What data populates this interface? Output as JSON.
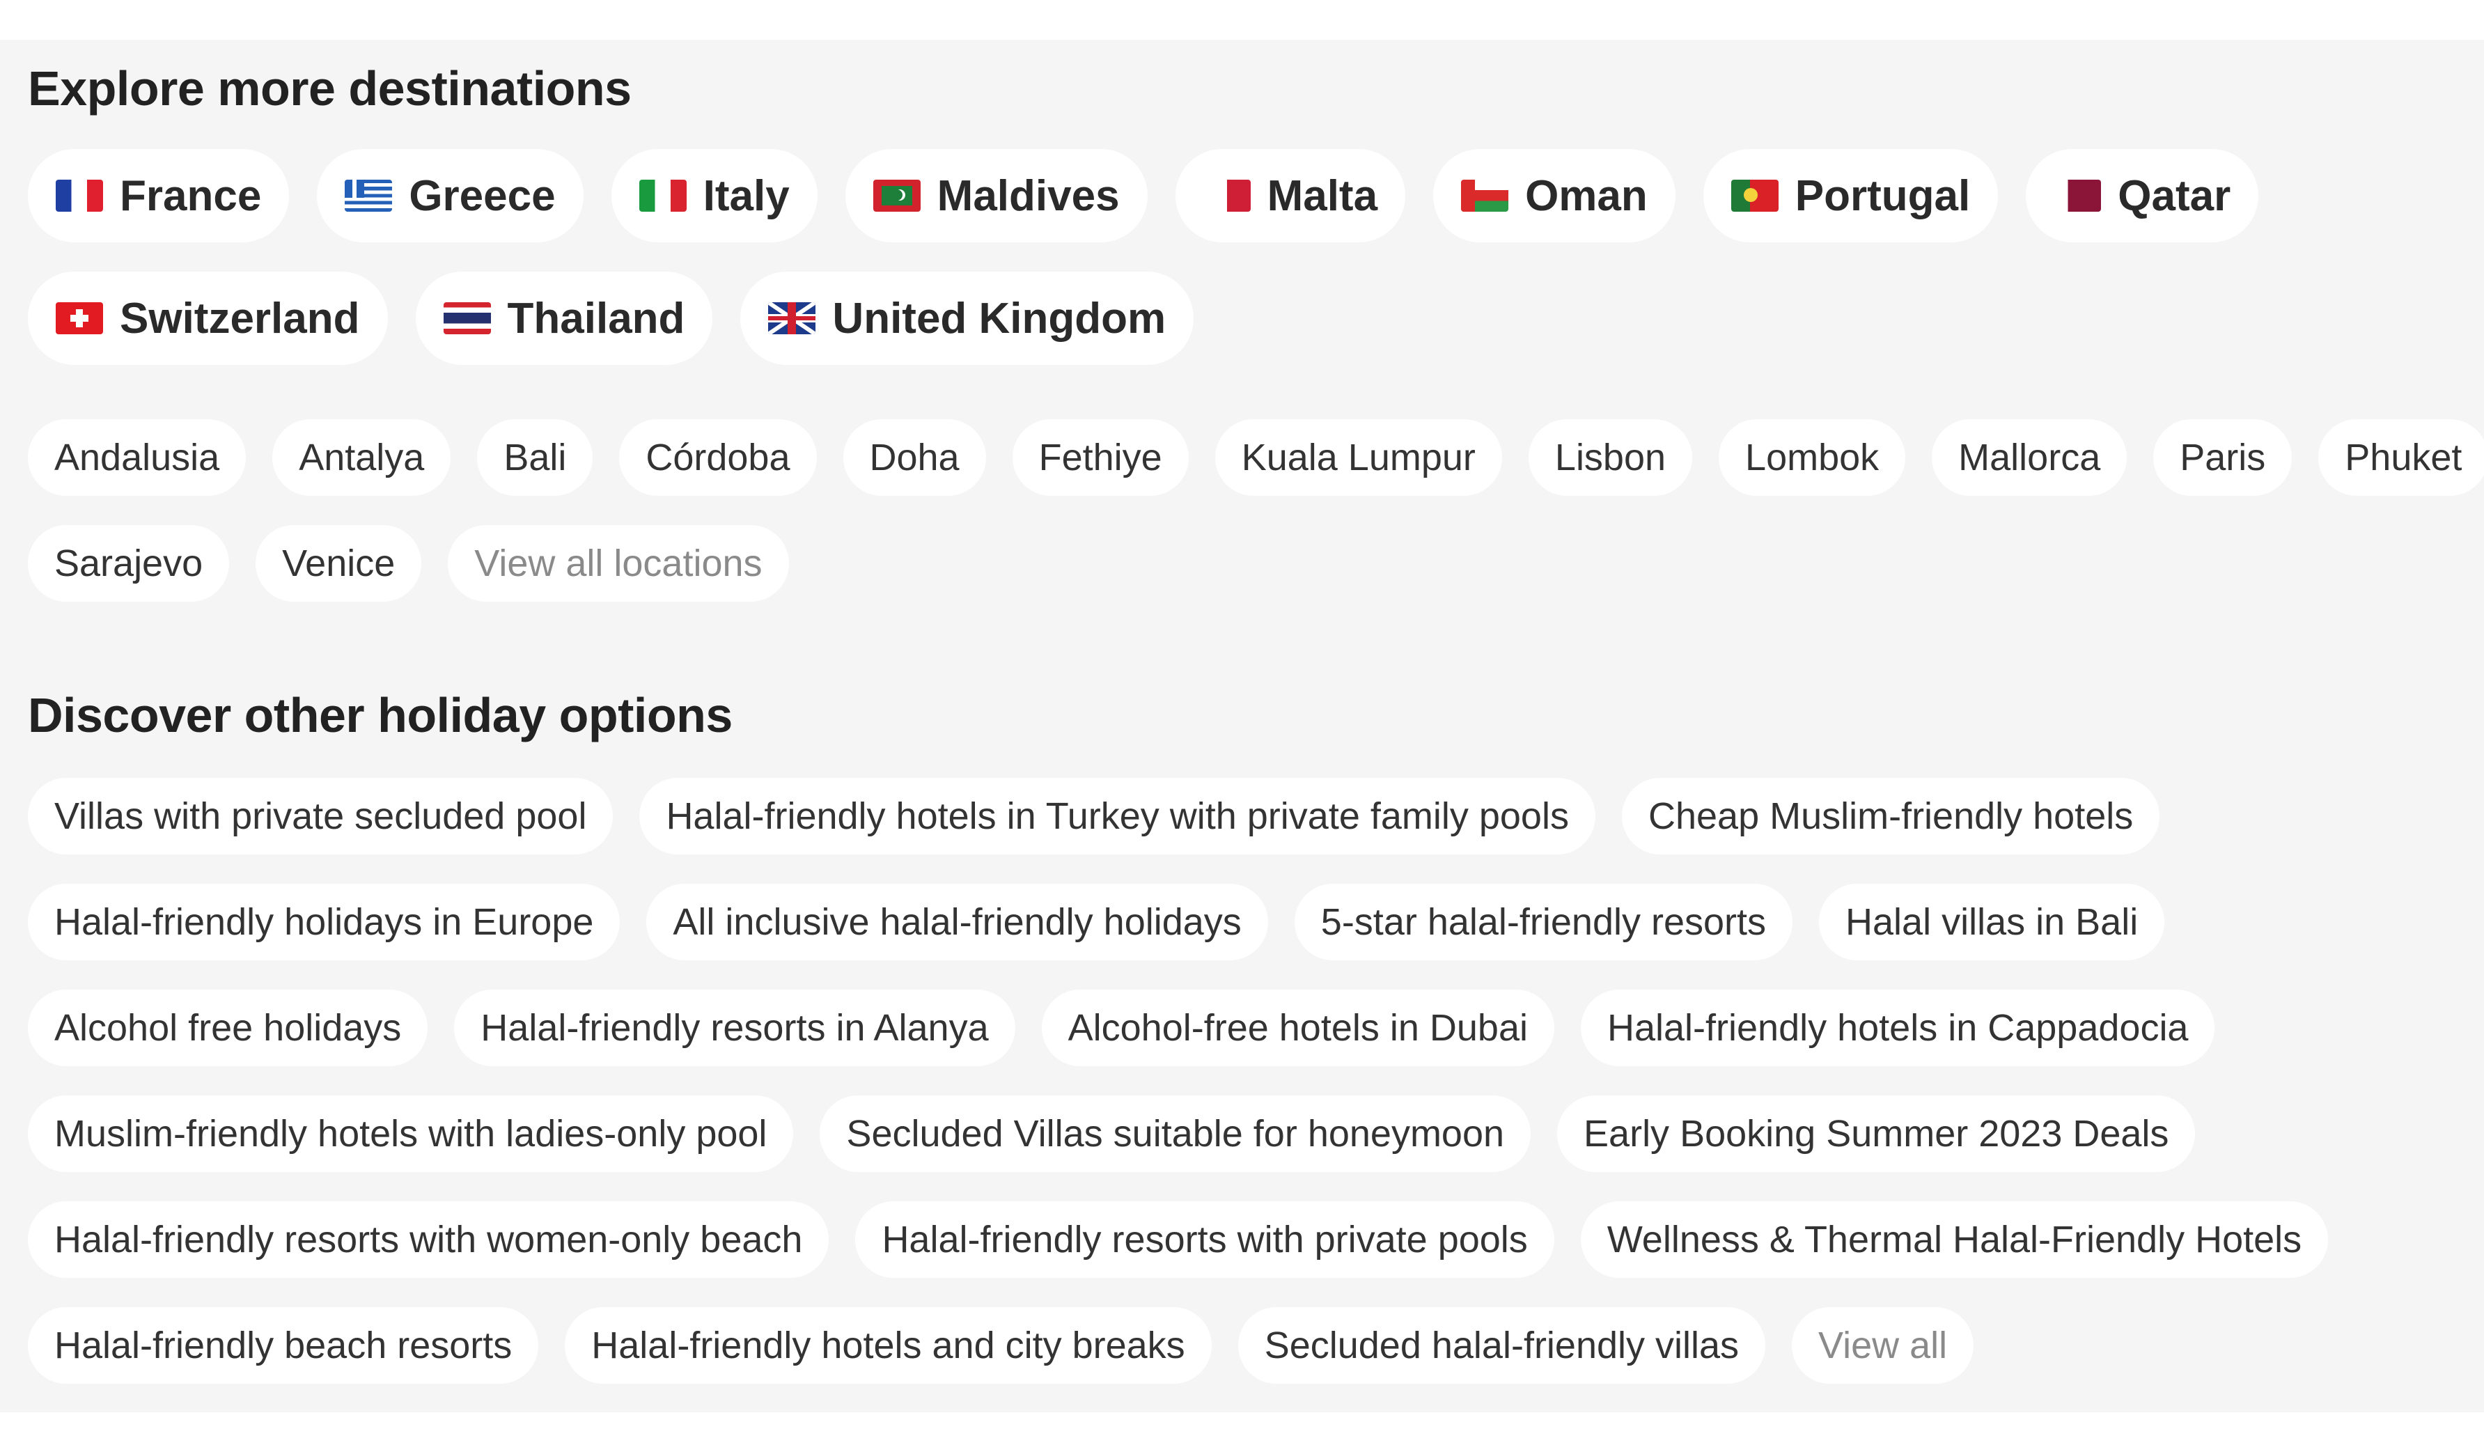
{
  "explore": {
    "title": "Explore more destinations",
    "countries": [
      {
        "label": "France",
        "flag": "flag-france"
      },
      {
        "label": "Greece",
        "flag": "flag-greece"
      },
      {
        "label": "Italy",
        "flag": "flag-italy"
      },
      {
        "label": "Maldives",
        "flag": "flag-maldives"
      },
      {
        "label": "Malta",
        "flag": "flag-malta"
      },
      {
        "label": "Oman",
        "flag": "flag-oman"
      },
      {
        "label": "Portugal",
        "flag": "flag-portugal"
      },
      {
        "label": "Qatar",
        "flag": "flag-qatar"
      },
      {
        "label": "Switzerland",
        "flag": "flag-switzerland"
      },
      {
        "label": "Thailand",
        "flag": "flag-thailand"
      },
      {
        "label": "United Kingdom",
        "flag": "flag-united-kingdom"
      }
    ],
    "cities": [
      "Andalusia",
      "Antalya",
      "Bali",
      "Córdoba",
      "Doha",
      "Fethiye",
      "Kuala Lumpur",
      "Lisbon",
      "Lombok",
      "Mallorca",
      "Paris",
      "Phuket",
      "Sarajevo",
      "Venice"
    ],
    "view_all_locations": "View all locations"
  },
  "holiday_options": {
    "title": "Discover other holiday options",
    "items": [
      "Villas with private secluded pool",
      "Halal-friendly hotels in Turkey with private family pools",
      "Cheap Muslim-friendly hotels",
      "Halal-friendly holidays in Europe",
      "All inclusive halal-friendly holidays",
      "5-star halal-friendly resorts",
      "Halal villas in Bali",
      "Alcohol free holidays",
      "Halal-friendly resorts in Alanya",
      "Alcohol-free hotels in Dubai",
      "Halal-friendly hotels in Cappadocia",
      "Muslim-friendly hotels with ladies-only pool",
      "Secluded Villas suitable for honeymoon",
      "Early Booking Summer 2023 Deals",
      "Halal-friendly resorts with women-only beach",
      "Halal-friendly resorts with private pools",
      "Wellness & Thermal Halal-Friendly Hotels",
      "Halal-friendly beach resorts",
      "Halal-friendly hotels and city breaks",
      "Secluded halal-friendly villas"
    ],
    "view_all": "View all"
  },
  "colors": {
    "panel_background": "#f5f5f5",
    "chip_background": "#ffffff",
    "text": "#333333",
    "muted_text": "#8a8a8a"
  }
}
